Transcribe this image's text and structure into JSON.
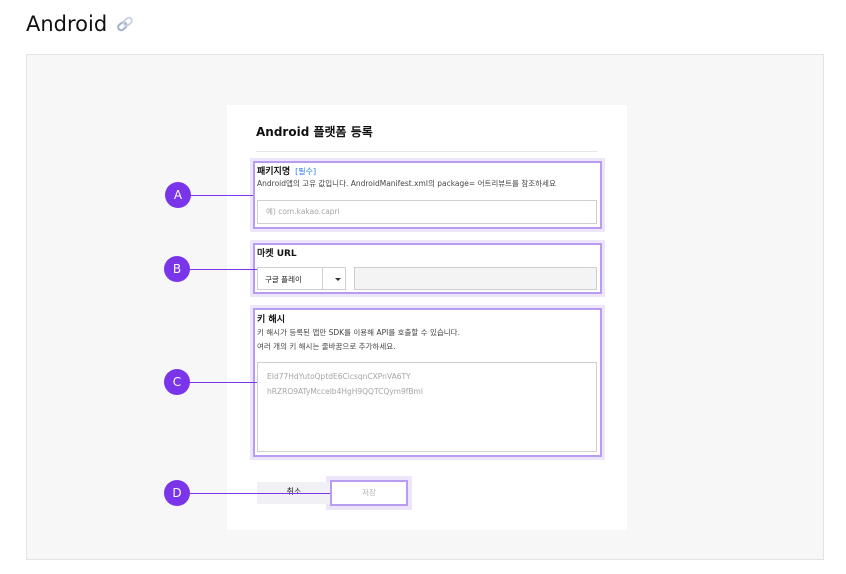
{
  "page": {
    "title": "Android"
  },
  "card": {
    "title": "Android 플랫폼 등록"
  },
  "package": {
    "label": "패키지명",
    "required": "[필수]",
    "description": "Android앱의 고유 값입니다. AndroidManifest.xml의 package= 어트리뷰트를 참조하세요",
    "placeholder": "예) com.kakao.capri"
  },
  "market": {
    "label": "마켓 URL",
    "selected": "구글 플레이",
    "url_value": ""
  },
  "keyhash": {
    "label": "키 해시",
    "description_1": "키 해시가 등록된 앱만 SDK를 이용해 API를 호출할 수 있습니다.",
    "description_2": "여러 개의 키 해시는 줄바꿈으로 추가하세요.",
    "placeholder_1": "EId77HdYutoQptdE6CicsqnCXPnVA6TY",
    "placeholder_2": "hRZRO9ATyMccelb4HgH9QQTCQym9fBml"
  },
  "actions": {
    "cancel": "취소",
    "save": "저장"
  },
  "callouts": {
    "a": "A",
    "b": "B",
    "c": "C",
    "d": "D"
  },
  "colors": {
    "accent": "#7a35ea",
    "highlight": "#b89cf2",
    "required_link": "#2e80e0"
  },
  "icons": {
    "title_link": "link-icon",
    "select_caret": "caret-down-icon"
  }
}
